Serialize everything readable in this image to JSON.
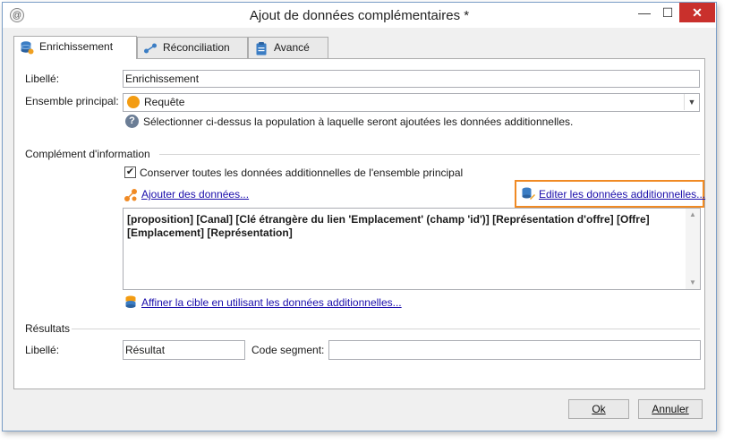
{
  "window": {
    "title": "Ajout de données complémentaires *",
    "controls": {
      "minimize": "—",
      "maximize": "☐",
      "close": "✕"
    }
  },
  "tabs": [
    {
      "label": "Enrichissement",
      "icon": "database-gear-icon",
      "active": true
    },
    {
      "label": "Réconciliation",
      "icon": "link-nodes-icon",
      "active": false
    },
    {
      "label": "Avancé",
      "icon": "clipboard-icon",
      "active": false
    }
  ],
  "form": {
    "libelle_label": "Libellé:",
    "libelle_value": "Enrichissement",
    "ensemble_label": "Ensemble principal:",
    "ensemble_value": "Requête",
    "ensemble_help": "Sélectionner ci-dessus la population à laquelle seront ajoutées les données additionnelles."
  },
  "complement": {
    "section_title": "Complément d'information",
    "checkbox_label": "Conserver toutes les données additionnelles de l'ensemble principal",
    "checkbox_checked": true,
    "add_link": "Ajouter des données...",
    "edit_link": "Editer les données additionnelles...",
    "data_text": " [proposition]  [Canal]  [Clé étrangère du lien 'Emplacement' (champ 'id')]  [Représentation d'offre]  [Offre]  [Emplacement]  [Représentation]",
    "refine_link": "Affiner la cible en utilisant les données additionnelles..."
  },
  "results": {
    "section_title": "Résultats",
    "libelle_label": "Libellé:",
    "libelle_value": "Résultat",
    "segment_label": "Code segment:",
    "segment_value": ""
  },
  "buttons": {
    "ok": "Ok",
    "cancel": "Annuler"
  },
  "colors": {
    "highlight": "#f08a24",
    "link": "#1a0dab",
    "close_button": "#c9302c",
    "ensemble_dot": "#f39c12"
  }
}
